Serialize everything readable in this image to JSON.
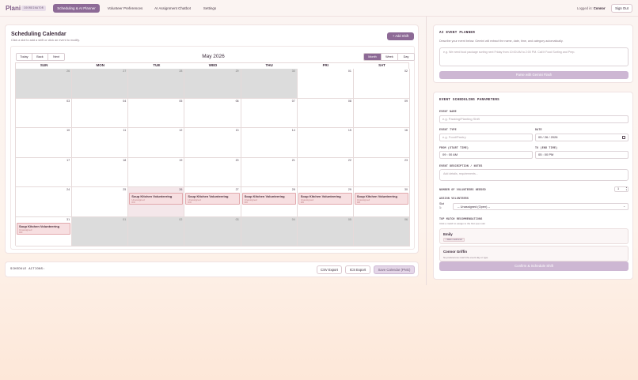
{
  "nav": {
    "logo": "Plani",
    "role": "COORDINATOR",
    "tabs": [
      {
        "label": "Scheduling & AI Planner",
        "active": true
      },
      {
        "label": "Volunteer Preferences",
        "active": false
      },
      {
        "label": "AI Assignment Chatbot",
        "active": false
      },
      {
        "label": "Settings",
        "active": false
      }
    ],
    "logged_prefix": "Logged in:",
    "logged_user": "Connor",
    "signout": "Sign Out"
  },
  "calendar": {
    "title": "Scheduling Calendar",
    "subtitle": "Click a slot to add a shift or click an event to modify.",
    "add_shift": "+ Add Shift",
    "nav_buttons": [
      "Today",
      "Back",
      "Next"
    ],
    "view_buttons": [
      {
        "label": "Month",
        "active": true
      },
      {
        "label": "Week",
        "active": false
      },
      {
        "label": "Day",
        "active": false
      }
    ],
    "month_label": "May 2026",
    "weekdays": [
      "SUN",
      "MON",
      "TUE",
      "WED",
      "THU",
      "FRI",
      "SAT"
    ],
    "weeks": [
      [
        {
          "d": "26",
          "off": true
        },
        {
          "d": "27",
          "off": true
        },
        {
          "d": "28",
          "off": true
        },
        {
          "d": "29",
          "off": true
        },
        {
          "d": "30",
          "off": true
        },
        {
          "d": "01"
        },
        {
          "d": "02"
        }
      ],
      [
        {
          "d": "03"
        },
        {
          "d": "04"
        },
        {
          "d": "05"
        },
        {
          "d": "06"
        },
        {
          "d": "07"
        },
        {
          "d": "08"
        },
        {
          "d": "09"
        }
      ],
      [
        {
          "d": "10"
        },
        {
          "d": "11"
        },
        {
          "d": "12"
        },
        {
          "d": "13"
        },
        {
          "d": "14"
        },
        {
          "d": "15"
        },
        {
          "d": "16"
        }
      ],
      [
        {
          "d": "17"
        },
        {
          "d": "18"
        },
        {
          "d": "19"
        },
        {
          "d": "20"
        },
        {
          "d": "21"
        },
        {
          "d": "22"
        },
        {
          "d": "23"
        }
      ],
      [
        {
          "d": "24"
        },
        {
          "d": "25"
        },
        {
          "d": "26",
          "today": true,
          "event": true
        },
        {
          "d": "27",
          "event": true
        },
        {
          "d": "28",
          "event": true
        },
        {
          "d": "29",
          "event": true
        },
        {
          "d": "30",
          "event": true
        }
      ],
      [
        {
          "d": "31",
          "event": true
        },
        {
          "d": "01",
          "off": true
        },
        {
          "d": "02",
          "off": true
        },
        {
          "d": "03",
          "off": true
        },
        {
          "d": "04",
          "off": true
        },
        {
          "d": "05",
          "off": true
        },
        {
          "d": "06",
          "off": true
        }
      ]
    ],
    "event": {
      "name": "Soup Kitchen Volunteering",
      "status": "Unassigned",
      "count": "0/0"
    }
  },
  "actions": {
    "label": "SCHEDULE ACTIONS:",
    "csv": "CSV Export",
    "ics": "ICS Export",
    "png": "Save Calendar (PNG)"
  },
  "ai_planner": {
    "title": "AI EVENT PLANNER",
    "subtitle": "Describe your event below. Gemini will extract the name, date, time, and category automatically.",
    "placeholder": "e.g. We need food package sorting next Friday from 10:00 AM to 2:00 PM. Call it Food Sorting and Prep.",
    "button": "Parse with Gemini Flash"
  },
  "params": {
    "title": "EVENT SCHEDULING PARAMETERS",
    "event_name_label": "EVENT NAME",
    "event_name_placeholder": "e.g. Packing/Planting Shift",
    "event_type_label": "EVENT TYPE",
    "event_type_placeholder": "e.g. Food/Pantry",
    "date_label": "DATE",
    "date_value": "05 / 26 / 2026",
    "from_label": "FROM (START TIME)",
    "from_value": "09 : 00  AM",
    "to_label": "TO (END TIME)",
    "to_value": "05 : 00  PM",
    "desc_label": "EVENT DESCRIPTION / NOTES",
    "desc_placeholder": "Add details, requirements...",
    "num_label": "NUMBER OF VOLUNTEERS NEEDED",
    "num_value": "1",
    "assign_label": "ASSIGN VOLUNTEERS",
    "slot_label_a": "Slot",
    "slot_label_b": "1:",
    "slot_value": "-- Unassigned (Open) --",
    "top_label": "TOP MATCH RECOMMENDATIONS",
    "top_sub": "Click a match to assign to the first open slot",
    "recs": [
      {
        "name": "Emily",
        "tag": "• Warm welcomer",
        "note": ""
      },
      {
        "name": "Connor Griffin",
        "tag": "",
        "note": "No preferences match the event day or type."
      }
    ],
    "confirm": "Confirm & Schedule Shift"
  }
}
